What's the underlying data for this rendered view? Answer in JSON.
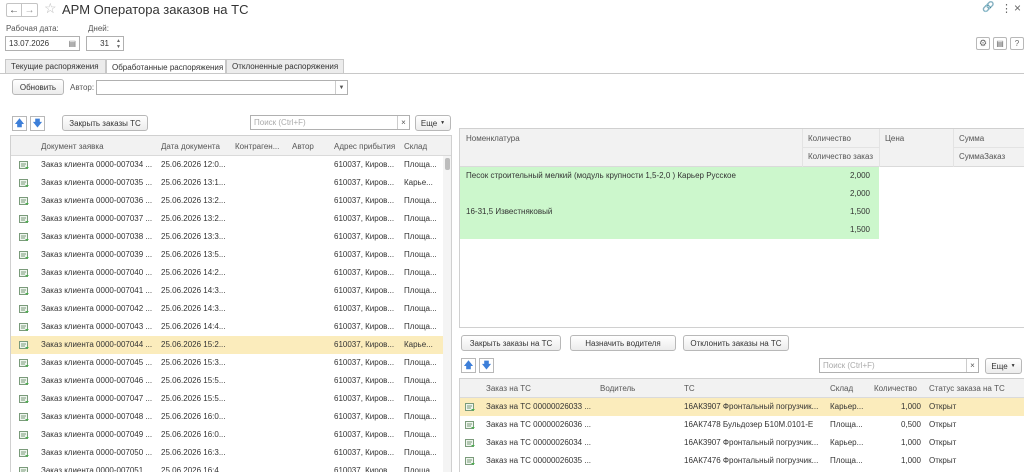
{
  "window": {
    "title": "АРМ Оператора заказов на ТС"
  },
  "filters": {
    "date_label": "Рабочая дата:",
    "date_value": "13.07.2026",
    "days_label": "Дней:",
    "days_value": "31"
  },
  "tabs": [
    {
      "label": "Текущие распоряжения",
      "active": false
    },
    {
      "label": "Обработанные распоряжения",
      "active": true
    },
    {
      "label": "Отклоненные распоряжения",
      "active": false
    }
  ],
  "toolbar": {
    "refresh_label": "Обновить",
    "author_label": "Автор:",
    "author_value": ""
  },
  "left_table": {
    "close_orders_label": "Закрыть заказы ТС",
    "search_placeholder": "Поиск (Ctrl+F)",
    "more_label": "Еще",
    "columns": [
      "Документ заявка",
      "Дата документа",
      "Контраген...",
      "Автор",
      "Адрес прибытия",
      "Склад"
    ],
    "rows": [
      {
        "doc": "Заказ клиента 0000-007034 ...",
        "date": "25.06.2026 12:0...",
        "contractor": "",
        "author": "",
        "address": "610037, Киров...",
        "warehouse": "Площа...",
        "selected": false
      },
      {
        "doc": "Заказ клиента 0000-007035 ...",
        "date": "25.06.2026 13:1...",
        "contractor": "",
        "author": "",
        "address": "610037, Киров...",
        "warehouse": "Карье...",
        "selected": false
      },
      {
        "doc": "Заказ клиента 0000-007036 ...",
        "date": "25.06.2026 13:2...",
        "contractor": "",
        "author": "",
        "address": "610037, Киров...",
        "warehouse": "Площа...",
        "selected": false
      },
      {
        "doc": "Заказ клиента 0000-007037 ...",
        "date": "25.06.2026 13:2...",
        "contractor": "",
        "author": "",
        "address": "610037, Киров...",
        "warehouse": "Площа...",
        "selected": false
      },
      {
        "doc": "Заказ клиента 0000-007038 ...",
        "date": "25.06.2026 13:3...",
        "contractor": "",
        "author": "",
        "address": "610037, Киров...",
        "warehouse": "Площа...",
        "selected": false
      },
      {
        "doc": "Заказ клиента 0000-007039 ...",
        "date": "25.06.2026 13:5...",
        "contractor": "",
        "author": "",
        "address": "610037, Киров...",
        "warehouse": "Площа...",
        "selected": false
      },
      {
        "doc": "Заказ клиента 0000-007040 ...",
        "date": "25.06.2026 14:2...",
        "contractor": "",
        "author": "",
        "address": "610037, Киров...",
        "warehouse": "Площа...",
        "selected": false
      },
      {
        "doc": "Заказ клиента 0000-007041 ...",
        "date": "25.06.2026 14:3...",
        "contractor": "",
        "author": "",
        "address": "610037, Киров...",
        "warehouse": "Площа...",
        "selected": false
      },
      {
        "doc": "Заказ клиента 0000-007042 ...",
        "date": "25.06.2026 14:3...",
        "contractor": "",
        "author": "",
        "address": "610037, Киров...",
        "warehouse": "Площа...",
        "selected": false
      },
      {
        "doc": "Заказ клиента 0000-007043 ...",
        "date": "25.06.2026 14:4...",
        "contractor": "",
        "author": "",
        "address": "610037, Киров...",
        "warehouse": "Площа...",
        "selected": false
      },
      {
        "doc": "Заказ клиента 0000-007044 ...",
        "date": "25.06.2026 15:2...",
        "contractor": "",
        "author": "",
        "address": "610037, Киров...",
        "warehouse": "Карье...",
        "selected": true
      },
      {
        "doc": "Заказ клиента 0000-007045 ...",
        "date": "25.06.2026 15:3...",
        "contractor": "",
        "author": "",
        "address": "610037, Киров...",
        "warehouse": "Площа...",
        "selected": false
      },
      {
        "doc": "Заказ клиента 0000-007046 ...",
        "date": "25.06.2026 15:5...",
        "contractor": "",
        "author": "",
        "address": "610037, Киров...",
        "warehouse": "Площа...",
        "selected": false
      },
      {
        "doc": "Заказ клиента 0000-007047 ...",
        "date": "25.06.2026 15:5...",
        "contractor": "",
        "author": "",
        "address": "610037, Киров...",
        "warehouse": "Площа...",
        "selected": false
      },
      {
        "doc": "Заказ клиента 0000-007048 ...",
        "date": "25.06.2026 16:0...",
        "contractor": "",
        "author": "",
        "address": "610037, Киров...",
        "warehouse": "Площа...",
        "selected": false
      },
      {
        "doc": "Заказ клиента 0000-007049 ...",
        "date": "25.06.2026 16:0...",
        "contractor": "",
        "author": "",
        "address": "610037, Киров...",
        "warehouse": "Площа...",
        "selected": false
      },
      {
        "doc": "Заказ клиента 0000-007050 ...",
        "date": "25.06.2026 16:3...",
        "contractor": "",
        "author": "",
        "address": "610037, Киров...",
        "warehouse": "Площа...",
        "selected": false
      },
      {
        "doc": "Заказ клиента 0000-007051 ...",
        "date": "25.06.2026 16:4...",
        "contractor": "",
        "author": "",
        "address": "610037, Киров...",
        "warehouse": "Площа...",
        "selected": false
      }
    ]
  },
  "nomenclature": {
    "columns": {
      "name": "Номенклатура",
      "qty": "Количество",
      "qty_sub": "Количество заказ",
      "price": "Цена",
      "sum": "Сумма",
      "sum_sub": "СуммаЗаказ"
    },
    "rows": [
      {
        "name": "Песок строительный мелкий (модуль крупности 1,5-2,0 ) Карьер Русское",
        "qty": "2,000",
        "qty_order": "2,000"
      },
      {
        "name": "16-31,5 Известняковый",
        "qty": "1,500",
        "qty_order": "1,500"
      }
    ]
  },
  "actions": {
    "close_ts_label": "Закрыть заказы на ТС",
    "assign_driver_label": "Назначить водителя",
    "reject_label": "Отклонить заказы на ТС"
  },
  "ts_table": {
    "search_placeholder": "Поиск (Ctrl+F)",
    "more_label": "Еще",
    "columns": [
      "Заказ на ТС",
      "Водитель",
      "ТС",
      "Склад",
      "Количество",
      "Статус заказа на ТС"
    ],
    "rows": [
      {
        "order": "Заказ на ТС 00000026033 ...",
        "driver": "",
        "ts": "16АК3907 Фронтальный погрузчик...",
        "warehouse": "Карьер...",
        "qty": "1,000",
        "status": "Открыт",
        "selected": true
      },
      {
        "order": "Заказ на ТС 00000026036 ...",
        "driver": "",
        "ts": "16АК7478 Бульдозер Б10М.0101-Е",
        "warehouse": "Площа...",
        "qty": "0,500",
        "status": "Открыт",
        "selected": false
      },
      {
        "order": "Заказ на ТС 00000026034 ...",
        "driver": "",
        "ts": "16АК3907 Фронтальный погрузчик...",
        "warehouse": "Карьер...",
        "qty": "1,000",
        "status": "Открыт",
        "selected": false
      },
      {
        "order": "Заказ на ТС 00000026035 ...",
        "driver": "",
        "ts": "16АК7476 Фронтальный погрузчик...",
        "warehouse": "Площа...",
        "qty": "1,000",
        "status": "Открыт",
        "selected": false
      }
    ]
  },
  "colors": {
    "selected_row": "#fbecbc",
    "green_row": "#ccf7cc",
    "accent_blue": "#3d7fd9"
  }
}
